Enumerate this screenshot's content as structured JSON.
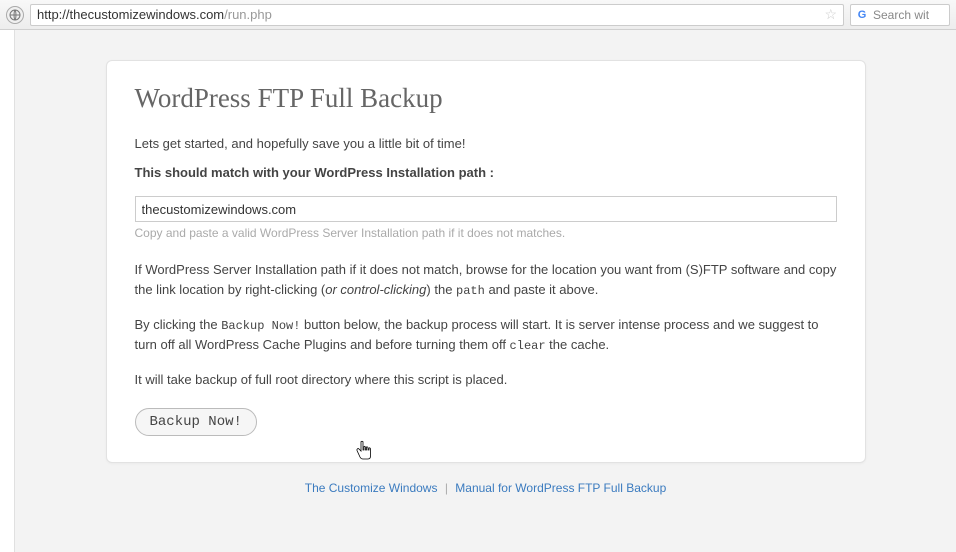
{
  "browser": {
    "url_domain": "http://thecustomizewindows.com",
    "url_path": "/run.php",
    "search_placeholder": "Search wit"
  },
  "page": {
    "title": "WordPress FTP Full Backup",
    "intro": "Lets get started, and hopefully save you a little bit of time!",
    "match_label": "This should match with your WordPress Installation path :",
    "path_value": "thecustomizewindows.com",
    "hint": "Copy and paste a valid WordPress Server Installation path if it does not matches.",
    "para1_a": "If WordPress Server Installation path if it does not match, browse for the location you want from (S)FTP software and copy the link location by right-clicking (",
    "para1_em": "or control-clicking",
    "para1_b": ") the ",
    "para1_mono": "path",
    "para1_c": " and paste it above.",
    "para2_a": "By clicking the ",
    "para2_mono1": "Backup Now!",
    "para2_b": " button below, the backup process will start. It is server intense process and we suggest to turn off all WordPress Cache Plugins and before turning them off ",
    "para2_mono2": "clear",
    "para2_c": " the cache.",
    "para3": "It will take backup of full root directory where this script is placed.",
    "backup_btn": "Backup Now!"
  },
  "footer": {
    "link1": "The Customize Windows",
    "sep": "|",
    "link2": "Manual for WordPress FTP Full Backup"
  }
}
